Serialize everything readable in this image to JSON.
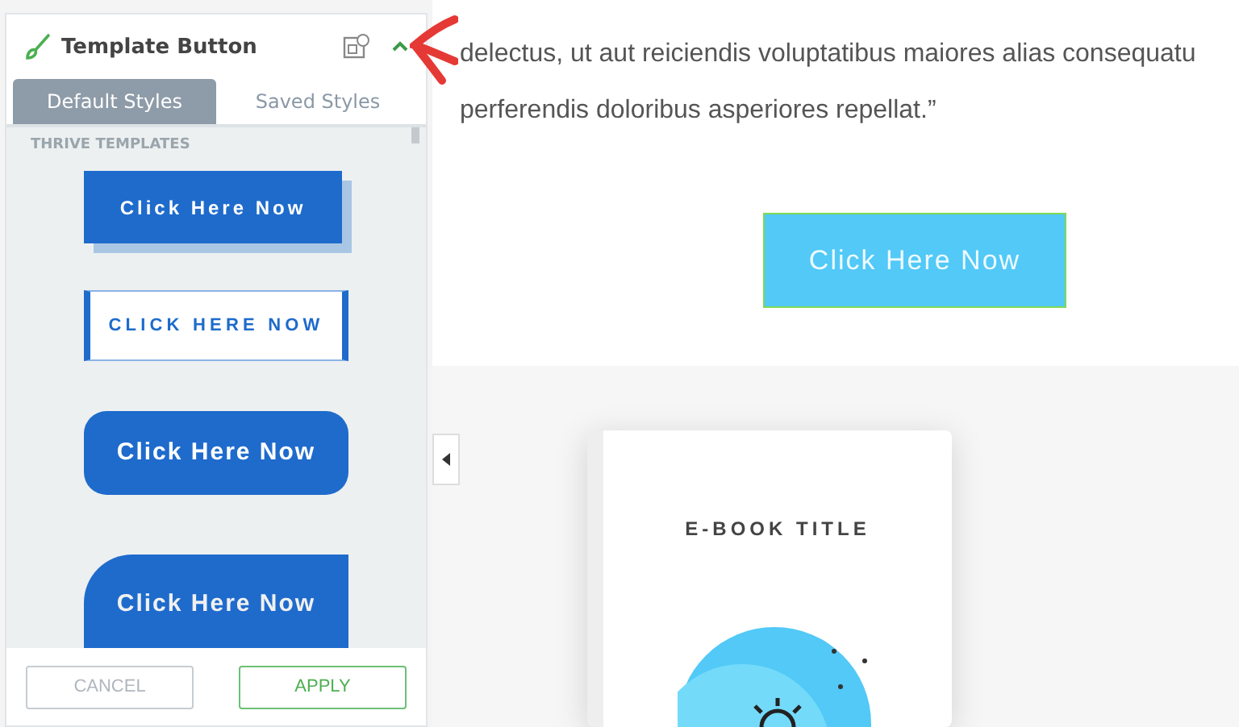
{
  "panel": {
    "title": "Template Button",
    "tabs": [
      {
        "label": "Default Styles",
        "selected": true
      },
      {
        "label": "Saved Styles",
        "selected": false
      }
    ],
    "section_label": "THRIVE TEMPLATES",
    "templates": [
      {
        "kind": "shadow",
        "label": "Click Here Now"
      },
      {
        "kind": "outline",
        "label": "CLICK HERE NOW"
      },
      {
        "kind": "rounded",
        "label": "Click Here Now"
      },
      {
        "kind": "leaf",
        "label": "Click Here Now"
      }
    ],
    "buttons": [
      {
        "label": "CANCEL",
        "kind": "secondary"
      },
      {
        "label": "APPLY",
        "kind": "primary"
      }
    ]
  },
  "content": {
    "paragraph_lines": [
      "delectus, ut aut reiciendis voluptatibus maiores alias consequatu",
      "perferendis doloribus asperiores repellat.”"
    ],
    "cta_button": "Click Here Now",
    "ebook_title": "E-BOOK TITLE"
  }
}
